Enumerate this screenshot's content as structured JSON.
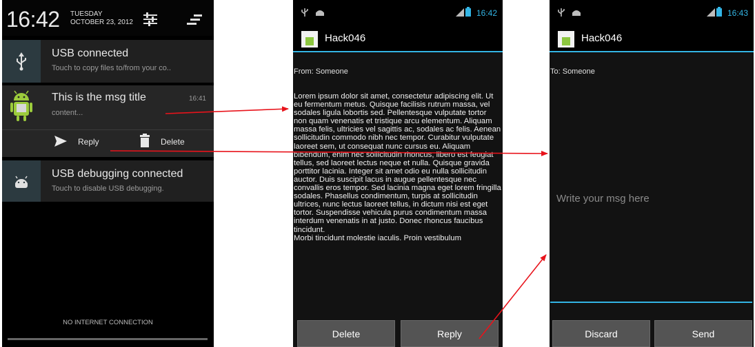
{
  "shade": {
    "time": "16:42",
    "day": "TUESDAY",
    "date": "OCTOBER 23, 2012",
    "notifications": [
      {
        "icon": "usb-icon",
        "title": "USB connected",
        "subtitle": "Touch to copy files to/from your co.."
      },
      {
        "icon": "android-app-icon",
        "title": "This is the msg title",
        "subtitle": "content...",
        "time": "16:41"
      },
      {
        "icon": "android-debug-icon",
        "title": "USB debugging connected",
        "subtitle": "Touch to disable USB debugging."
      }
    ],
    "actions": {
      "reply": "Reply",
      "delete": "Delete"
    },
    "footer": "NO INTERNET CONNECTION"
  },
  "read_screen": {
    "clock": "16:42",
    "app_title": "Hack046",
    "from": "From: Someone",
    "body": "Lorem ipsum dolor sit amet, consectetur adipiscing elit. Ut eu fermentum metus. Quisque facilisis rutrum massa, vel sodales ligula lobortis sed. Pellentesque vulputate tortor non quam venenatis et tristique arcu elementum. Aliquam massa felis, ultricies vel sagittis ac, sodales ac felis. Aenean sollicitudin commodo nibh nec tempor. Curabitur vulputate laoreet sem, ut consequat nunc cursus eu. Aliquam bibendum, enim nec sollicitudin rhoncus, libero est feugiat tellus, sed laoreet lectus neque et nulla. Quisque gravida porttitor lacinia. Integer sit amet odio eu nulla sollicitudin auctor. Duis suscipit lacus in augue pellentesque nec convallis eros tempor. Sed lacinia magna eget lorem fringilla sodales. Phasellus condimentum, turpis at sollicitudin ultrices, nunc lectus laoreet tellus, in dictum nisi est eget tortor. Suspendisse vehicula purus condimentum massa interdum venenatis in at justo. Donec rhoncus faucibus tincidunt.",
    "body_2": "Morbi tincidunt molestie iaculis. Proin vestibulum",
    "delete_label": "Delete",
    "reply_label": "Reply"
  },
  "compose_screen": {
    "clock": "16:43",
    "app_title": "Hack046",
    "to": "To: Someone",
    "placeholder": "Write your msg here",
    "discard_label": "Discard",
    "send_label": "Send"
  },
  "colors": {
    "accent": "#33b5e5",
    "arrow": "#e8131b"
  }
}
